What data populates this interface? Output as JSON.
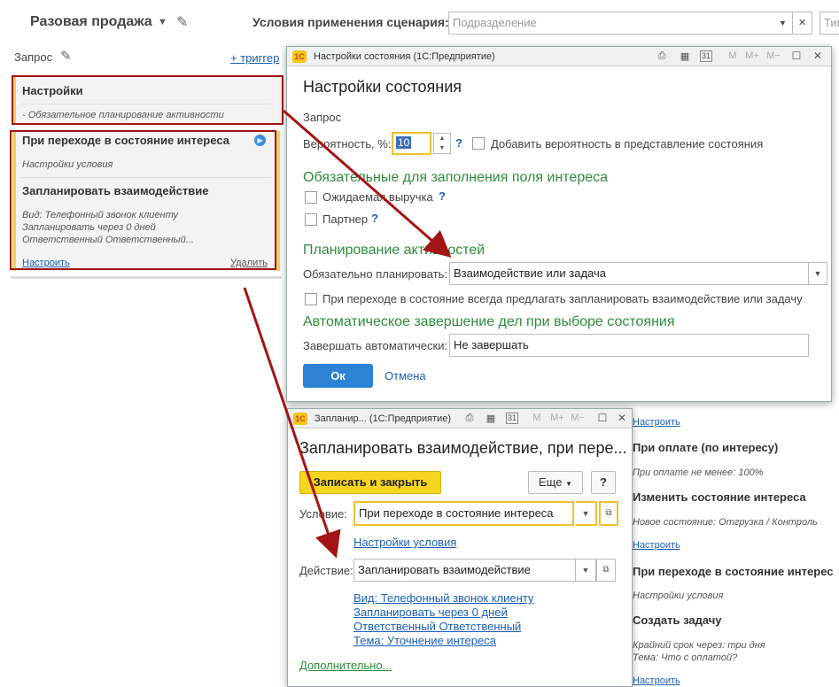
{
  "main": {
    "title": "Разовая продажа",
    "conditions_label": "Условия применения сценария:",
    "subdivision_placeholder": "Подразделение",
    "type_placeholder": "Тип",
    "request_label": "Запрос",
    "add_trigger": "+ триггер",
    "card_settings_title": "Настройки",
    "card_settings_note": "- Обязательное планирование активности",
    "card_transition_title": "При переходе в состояние интереса",
    "card_transition_cond": "Настройки условия",
    "card_plan_title": "Запланировать взаимодействие",
    "card_plan_details": [
      "Вид: Телефонный звонок клиенту",
      "Запланировать через 0 дней",
      "Ответственный Ответственный..."
    ],
    "card_configure": "Настроить",
    "card_delete": "Удалить"
  },
  "right": {
    "configure1": "Настроить",
    "payment_title": "При оплате (по интересу)",
    "payment_note": "При оплате не менее: 100%",
    "change_title": "Изменить состояние интереса",
    "change_note": "Новое состояние: Отгрузка / Контроль",
    "configure2": "Настроить",
    "transition_title": "При переходе в состояние интерес",
    "transition_note": "Настройки условия",
    "task_title": "Создать задачу",
    "task_note1": "Крайний срок через: три дня",
    "task_note2": "Тема: Что с оплатой?",
    "configure3": "Настроить"
  },
  "win1": {
    "window_title": "Настройки состояния  (1С:Предприятие)",
    "heading": "Настройки состояния",
    "state_name": "Запрос",
    "prob_label": "Вероятность, %:",
    "prob_value": "10",
    "help": "?",
    "add_prob_label": "Добавить вероятность в представление состояния",
    "section_required": "Обязательные для заполнения поля интереса",
    "expected_revenue": "Ожидаемая выручка",
    "partner": "Партнер",
    "section_planning": "Планирование активностей",
    "must_plan_label": "Обязательно планировать:",
    "must_plan_value": "Взаимодействие или задача",
    "always_offer": "При переходе в состояние всегда предлагать  запланировать взаимодействие или задачу",
    "section_auto": "Автоматическое завершение дел при  выборе  состояния",
    "auto_label": "Завершать автоматически:",
    "auto_value": "Не завершать",
    "ok": "Ок",
    "cancel": "Отмена"
  },
  "win2": {
    "window_title": "Запланир...  (1С:Предприятие)",
    "heading": "Запланировать взаимодействие, при пере...",
    "save_close": "Записать и закрыть",
    "more": "Еще",
    "help": "?",
    "condition_label": "Условие:",
    "condition_value": "При переходе в состояние интереса",
    "condition_settings": "Настройки условия",
    "action_label": "Действие:",
    "action_value": "Запланировать взаимодействие",
    "detail_links": [
      "Вид: Телефонный звонок клиенту",
      "Запланировать через 0 дней",
      "Ответственный Ответственный",
      "Тема: Уточнение интереса"
    ],
    "additional": "Дополнительно..."
  },
  "toolbar": {
    "m": "M",
    "m_plus": "M+",
    "m_minus": "M−",
    "calendar_day": "31"
  },
  "colors": {
    "accent_blue": "#2c83d6",
    "section_green": "#2e8b3e",
    "highlight_yellow": "#f0c030",
    "annotation_red": "#a31515"
  }
}
